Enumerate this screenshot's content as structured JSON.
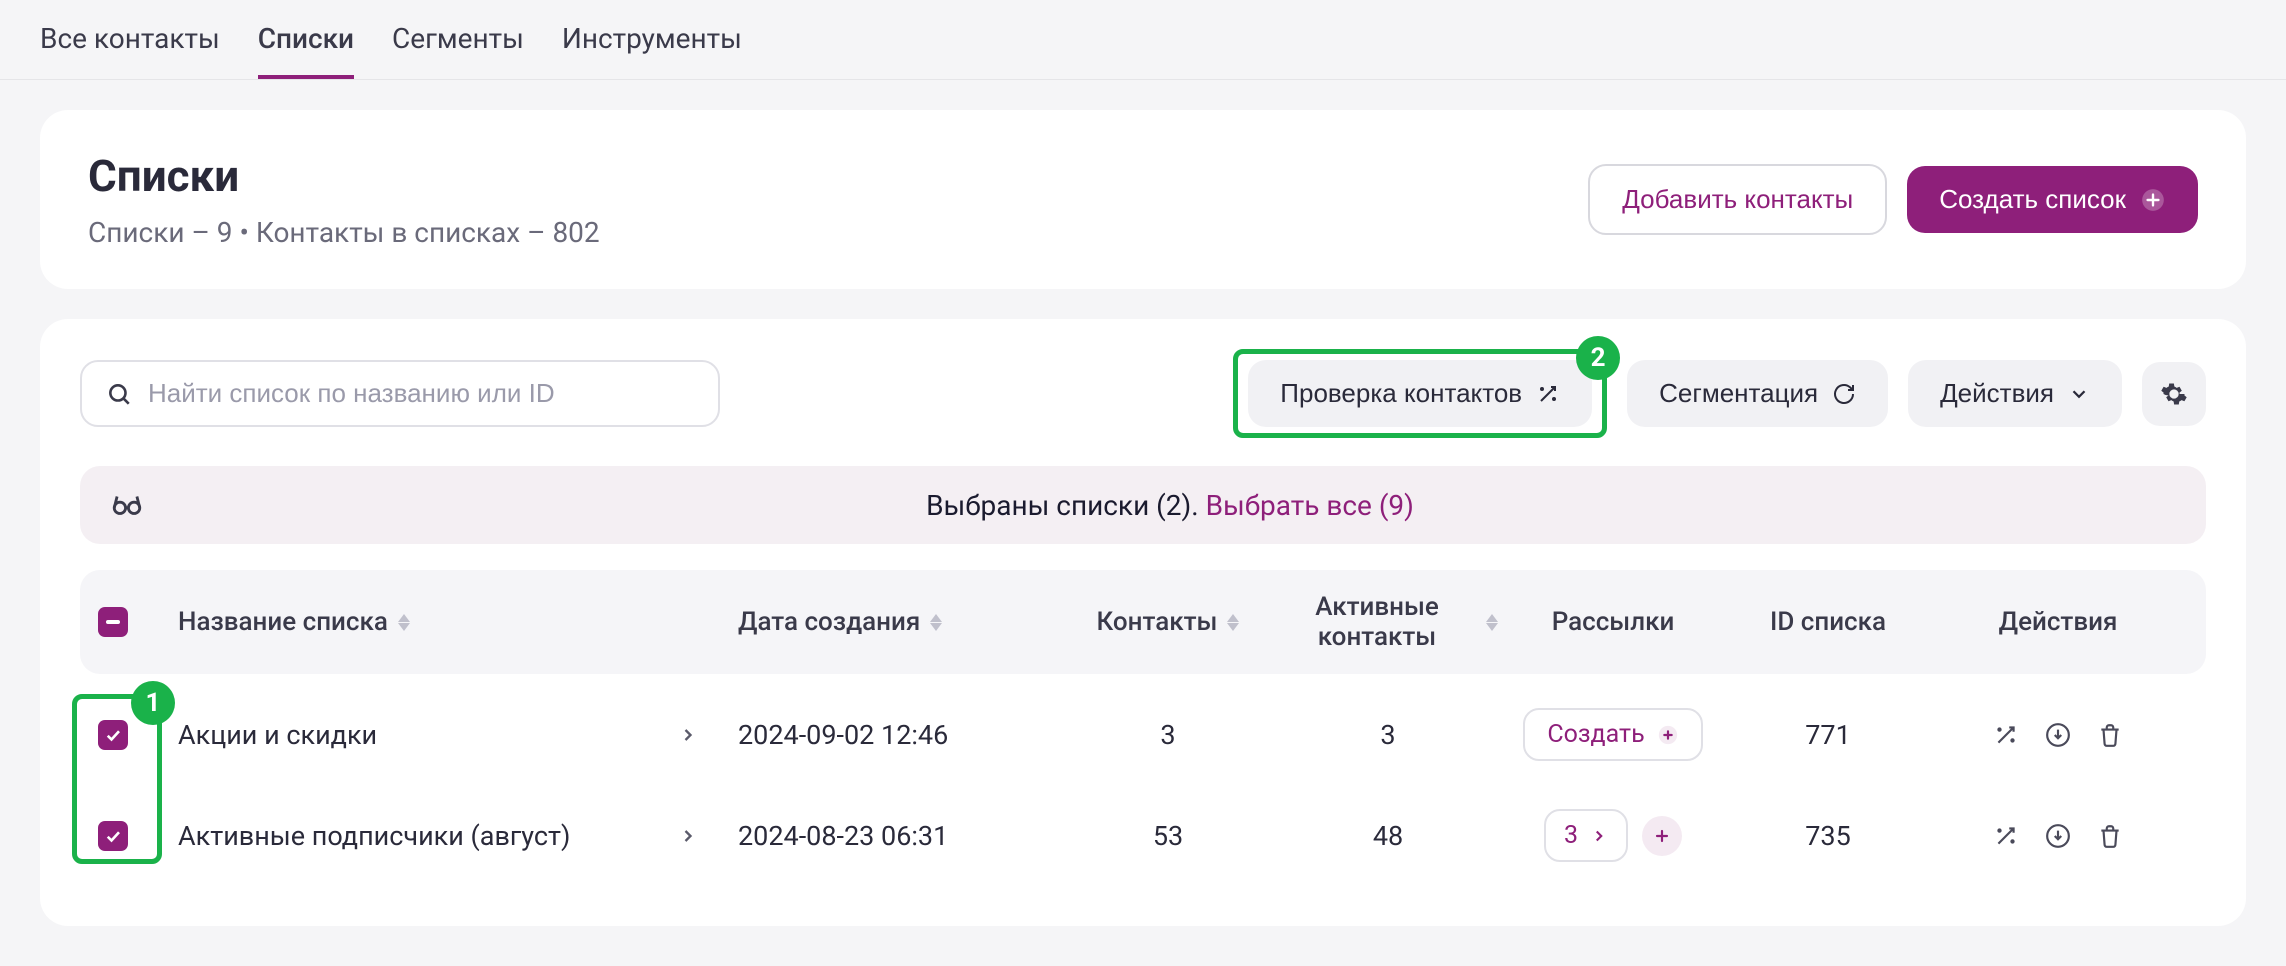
{
  "tabs": {
    "all_contacts": "Все контакты",
    "lists": "Списки",
    "segments": "Сегменты",
    "tools": "Инструменты"
  },
  "header": {
    "title": "Списки",
    "subtitle": "Списки – 9 • Контакты в списках – 802",
    "add_contacts": "Добавить контакты",
    "create_list": "Создать список"
  },
  "toolbar": {
    "search_placeholder": "Найти список по названию или ID",
    "check_contacts": "Проверка контактов",
    "segmentation": "Сегментация",
    "actions": "Действия"
  },
  "selection": {
    "text": "Выбраны списки (2).",
    "select_all": "Выбрать все (9)"
  },
  "callouts": {
    "one": "1",
    "two": "2"
  },
  "columns": {
    "name": "Название списка",
    "created": "Дата создания",
    "contacts": "Контакты",
    "active": "Активные контакты",
    "campaigns": "Рассылки",
    "id": "ID списка",
    "actions": "Действия"
  },
  "rows": [
    {
      "name": "Акции и скидки",
      "created": "2024-09-02 12:46",
      "contacts": "3",
      "active": "3",
      "campaigns_type": "create",
      "campaigns_label": "Создать",
      "id": "771"
    },
    {
      "name": "Активные подписчики (август)",
      "created": "2024-08-23 06:31",
      "contacts": "53",
      "active": "48",
      "campaigns_type": "count",
      "campaigns_label": "3",
      "id": "735"
    }
  ]
}
